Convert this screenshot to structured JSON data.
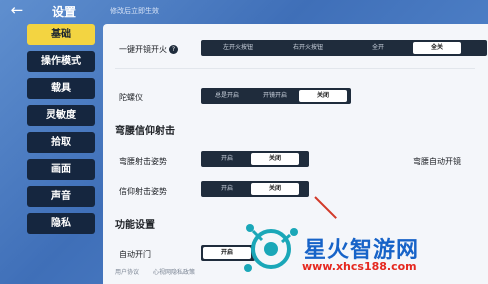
{
  "header": {
    "title": "设置",
    "hint": "修改后立即生效"
  },
  "sidebar": {
    "items": [
      {
        "label": "基础",
        "active": true
      },
      {
        "label": "操作模式",
        "active": false
      },
      {
        "label": "载具",
        "active": false
      },
      {
        "label": "灵敏度",
        "active": false
      },
      {
        "label": "拾取",
        "active": false
      },
      {
        "label": "画面",
        "active": false
      },
      {
        "label": "声音",
        "active": false
      },
      {
        "label": "隐私",
        "active": false
      }
    ]
  },
  "settings": {
    "one_key_fire": {
      "label": "一键开镜开火",
      "help": "?",
      "options": [
        "左开火按钮",
        "右开火按钮",
        "全开",
        "全关"
      ],
      "selected": "全关"
    },
    "gyroscope": {
      "label": "陀螺仪",
      "options": [
        "总是开启",
        "开镜开启",
        "关闭"
      ],
      "selected": "关闭"
    },
    "hip_fire_section": "弯腰信仰射击",
    "hip_fire_stance": {
      "label": "弯腰射击姿势",
      "options": [
        "开启",
        "关闭"
      ],
      "selected": "关闭"
    },
    "hip_fire_auto_scope": {
      "label": "弯腰自动开镜"
    },
    "faith_fire_stance": {
      "label": "信仰射击姿势",
      "options": [
        "开启",
        "关闭"
      ],
      "selected": "关闭"
    },
    "function_section": "功能设置",
    "auto_open_door": {
      "label": "自动开门",
      "options": [
        "开启"
      ],
      "selected": "开启"
    }
  },
  "footer": {
    "links": [
      "用户协议",
      "心视网隐私政策"
    ]
  },
  "watermark": {
    "brand": "星火智游网",
    "url": "www.xhcs188.com"
  },
  "colors": {
    "active_tab": "#f3d441",
    "tab_bg": "#15263f",
    "segment_bg": "#1f2c3c",
    "selected_segment": "#ffffff",
    "watermark_blue": "#1763c8",
    "watermark_red": "#e5281f"
  }
}
